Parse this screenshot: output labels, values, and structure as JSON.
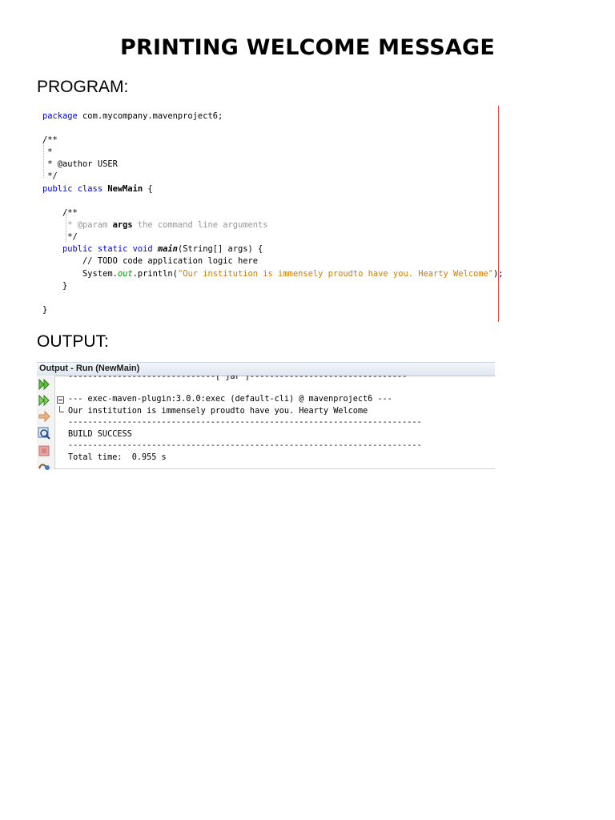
{
  "title": "PRINTING WELCOME MESSAGE",
  "sections": {
    "program": "PROGRAM:",
    "output": "OUTPUT:"
  },
  "code": {
    "l1_kw": "package",
    "l1_rest": " com.mycompany.mavenproject6;",
    "l3": "/**",
    "l4": " *",
    "l5": " * @author USER",
    "l6": " */",
    "l7_kw": "public class",
    "l7_name": "NewMain",
    "l7_rest": " {",
    "l9": "    /**",
    "l10_a": "     * @param ",
    "l10_b": "args",
    "l10_c": " the command line arguments",
    "l11": "     */",
    "l12_kw": "    public static void",
    "l12_name": "main",
    "l12_rest": "(String[] args) {",
    "l13": "        // TODO code application logic here",
    "l14_a": "        System.",
    "l14_b": "out",
    "l14_c": ".println(",
    "l14_str": "\"Our institution is immensely proudto have you. Hearty Welcome\"",
    "l14_end": ");",
    "l15": "    }",
    "l17": "}"
  },
  "output_panel": {
    "title": "Output - Run (NewMain)",
    "lines": {
      "o1": "------------------------------[ jar ]--------------------------------",
      "o2": "--- exec-maven-plugin:3.0.0:exec (default-cli) @ mavenproject6 ---",
      "o3": "Our institution is immensely proudto have you. Hearty Welcome",
      "o4": "------------------------------------------------------------------------",
      "o5": "BUILD SUCCESS",
      "o6": "------------------------------------------------------------------------",
      "o7": "Total time:  0.955 s"
    },
    "toolbar_icons": [
      "rerun-icon",
      "rerun-with-options-icon",
      "stop-arrow-icon",
      "settings-search-icon",
      "stop-icon",
      "clear-icon"
    ],
    "colors": {
      "success": "#009900",
      "keyword": "#0000e6",
      "comment": "#969696",
      "string": "#ce7b00"
    }
  }
}
